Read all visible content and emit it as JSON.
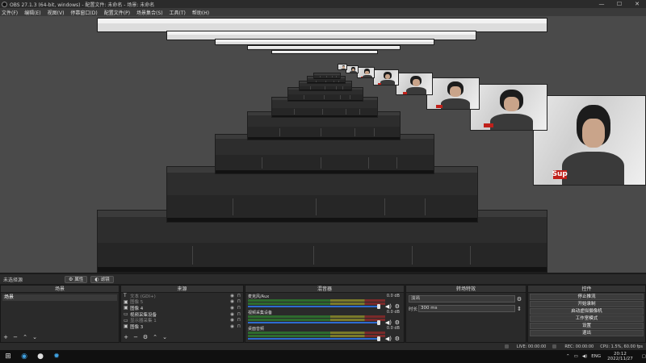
{
  "window": {
    "title": "OBS 27.1.3 (64-bit, windows) - 配置文件: 未命名 - 场景: 未命名",
    "minimize": "—",
    "maximize": "☐",
    "close": "✕"
  },
  "menu": [
    "文件(F)",
    "编辑(E)",
    "视图(V)",
    "停靠窗口(D)",
    "配置文件(P)",
    "场景集合(S)",
    "工具(T)",
    "帮助(H)"
  ],
  "scene_strip": {
    "current_scene": "未选择源",
    "properties_label": "属性",
    "filters_label": "滤镜"
  },
  "scenes": {
    "title": "场景",
    "items": [
      "场景"
    ]
  },
  "sources": {
    "title": "来源",
    "items": [
      {
        "icon": "text-icon",
        "glyph": "T",
        "name": "文本 (GDI+)",
        "dim": true
      },
      {
        "icon": "image-icon",
        "glyph": "▣",
        "name": "图像 5",
        "dim": true
      },
      {
        "icon": "image-icon",
        "glyph": "▣",
        "name": "图像 4",
        "dim": false
      },
      {
        "icon": "camera-icon",
        "glyph": "▭",
        "name": "视频采集设备",
        "dim": false
      },
      {
        "icon": "display-icon",
        "glyph": "▭",
        "name": "显示器采集 1",
        "dim": true
      },
      {
        "icon": "image-icon",
        "glyph": "▣",
        "name": "图像 3",
        "dim": false
      }
    ]
  },
  "mixer": {
    "title": "混音器",
    "channels": [
      {
        "name": "麦克风/Aux",
        "value": "0.0 dB",
        "level": 0.96
      },
      {
        "name": "视频采集设备",
        "value": "0.0 dB",
        "level": 0.96
      },
      {
        "name": "桌面音频",
        "value": "0.0 dB",
        "level": 0.96
      }
    ]
  },
  "transitions": {
    "title": "转场特效",
    "type": "淡出",
    "duration_label": "时长",
    "duration_value": "300 ms"
  },
  "controls": {
    "title": "控件",
    "buttons": [
      "停止推流",
      "开始录制",
      "启动虚拟摄像机",
      "工作室模式",
      "设置",
      "退出"
    ]
  },
  "status": {
    "live": "LIVE: 00:00:00",
    "rec": "REC: 00:00:00",
    "cpu": "CPU: 1.5%, 60.00 fps"
  },
  "taskbar": {
    "lang": "ENG",
    "time": "20:12",
    "date": "2022/11/27"
  },
  "colors": {
    "accent": "#2d6bd1",
    "meter_green": "#2e6b2e",
    "brand_red": "#c0201a"
  },
  "camera_overlay_text": "Sup"
}
